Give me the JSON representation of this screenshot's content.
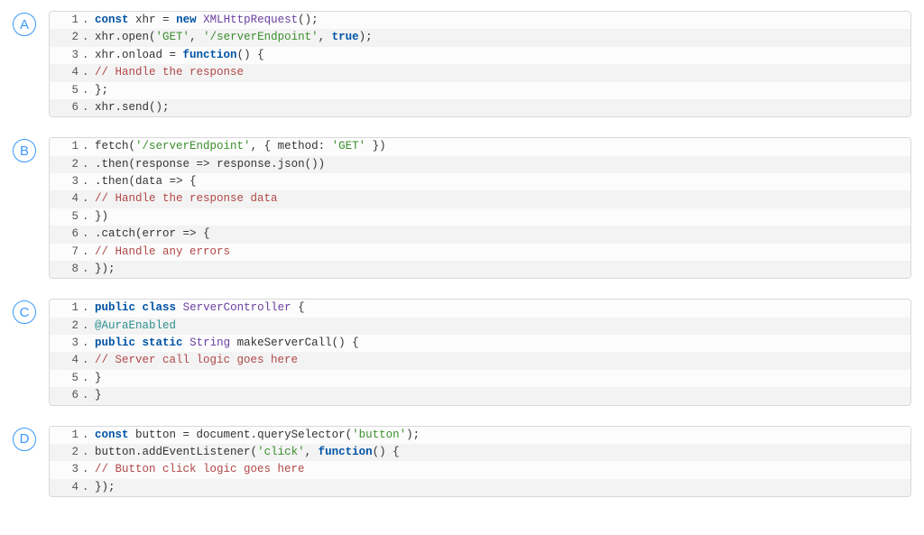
{
  "options": [
    {
      "letter": "A",
      "lines": [
        [
          {
            "t": "kw",
            "v": "const"
          },
          {
            "t": "p",
            "v": " xhr "
          },
          {
            "t": "op",
            "v": "="
          },
          {
            "t": "p",
            "v": " "
          },
          {
            "t": "kw",
            "v": "new"
          },
          {
            "t": "p",
            "v": " "
          },
          {
            "t": "cls",
            "v": "XMLHttpRequest"
          },
          {
            "t": "p",
            "v": "();"
          }
        ],
        [
          {
            "t": "p",
            "v": "xhr."
          },
          {
            "t": "fn",
            "v": "open"
          },
          {
            "t": "p",
            "v": "("
          },
          {
            "t": "str",
            "v": "'GET'"
          },
          {
            "t": "p",
            "v": ", "
          },
          {
            "t": "str",
            "v": "'/serverEndpoint'"
          },
          {
            "t": "p",
            "v": ", "
          },
          {
            "t": "kw",
            "v": "true"
          },
          {
            "t": "p",
            "v": ");"
          }
        ],
        [
          {
            "t": "p",
            "v": "xhr.onload "
          },
          {
            "t": "op",
            "v": "="
          },
          {
            "t": "p",
            "v": " "
          },
          {
            "t": "kw",
            "v": "function"
          },
          {
            "t": "p",
            "v": "() {"
          }
        ],
        [
          {
            "t": "cmt",
            "v": "// Handle the response"
          }
        ],
        [
          {
            "t": "p",
            "v": "};"
          }
        ],
        [
          {
            "t": "p",
            "v": "xhr."
          },
          {
            "t": "fn",
            "v": "send"
          },
          {
            "t": "p",
            "v": "();"
          }
        ]
      ]
    },
    {
      "letter": "B",
      "lines": [
        [
          {
            "t": "fn",
            "v": "fetch"
          },
          {
            "t": "p",
            "v": "("
          },
          {
            "t": "str",
            "v": "'/serverEndpoint'"
          },
          {
            "t": "p",
            "v": ", { method: "
          },
          {
            "t": "str",
            "v": "'GET'"
          },
          {
            "t": "p",
            "v": " })"
          }
        ],
        [
          {
            "t": "p",
            "v": "."
          },
          {
            "t": "fn",
            "v": "then"
          },
          {
            "t": "p",
            "v": "(response "
          },
          {
            "t": "op",
            "v": "=>"
          },
          {
            "t": "p",
            "v": " response."
          },
          {
            "t": "fn",
            "v": "json"
          },
          {
            "t": "p",
            "v": "())"
          }
        ],
        [
          {
            "t": "p",
            "v": "."
          },
          {
            "t": "fn",
            "v": "then"
          },
          {
            "t": "p",
            "v": "(data "
          },
          {
            "t": "op",
            "v": "=>"
          },
          {
            "t": "p",
            "v": " {"
          }
        ],
        [
          {
            "t": "cmt",
            "v": "// Handle the response data"
          }
        ],
        [
          {
            "t": "p",
            "v": "})"
          }
        ],
        [
          {
            "t": "p",
            "v": "."
          },
          {
            "t": "fn",
            "v": "catch"
          },
          {
            "t": "p",
            "v": "(error "
          },
          {
            "t": "op",
            "v": "=>"
          },
          {
            "t": "p",
            "v": " {"
          }
        ],
        [
          {
            "t": "cmt",
            "v": "// Handle any errors"
          }
        ],
        [
          {
            "t": "p",
            "v": "});"
          }
        ]
      ]
    },
    {
      "letter": "C",
      "lines": [
        [
          {
            "t": "kw",
            "v": "public"
          },
          {
            "t": "p",
            "v": " "
          },
          {
            "t": "kw",
            "v": "class"
          },
          {
            "t": "p",
            "v": " "
          },
          {
            "t": "cls",
            "v": "ServerController"
          },
          {
            "t": "p",
            "v": " {"
          }
        ],
        [
          {
            "t": "ann",
            "v": "@AuraEnabled"
          }
        ],
        [
          {
            "t": "kw",
            "v": "public"
          },
          {
            "t": "p",
            "v": " "
          },
          {
            "t": "kw",
            "v": "static"
          },
          {
            "t": "p",
            "v": " "
          },
          {
            "t": "cls",
            "v": "String"
          },
          {
            "t": "p",
            "v": " "
          },
          {
            "t": "fn",
            "v": "makeServerCall"
          },
          {
            "t": "p",
            "v": "() {"
          }
        ],
        [
          {
            "t": "cmt",
            "v": "// Server call logic goes here"
          }
        ],
        [
          {
            "t": "p",
            "v": "}"
          }
        ],
        [
          {
            "t": "p",
            "v": "}"
          }
        ]
      ]
    },
    {
      "letter": "D",
      "lines": [
        [
          {
            "t": "kw",
            "v": "const"
          },
          {
            "t": "p",
            "v": " button "
          },
          {
            "t": "op",
            "v": "="
          },
          {
            "t": "p",
            "v": " document."
          },
          {
            "t": "fn",
            "v": "querySelector"
          },
          {
            "t": "p",
            "v": "("
          },
          {
            "t": "str",
            "v": "'button'"
          },
          {
            "t": "p",
            "v": ");"
          }
        ],
        [
          {
            "t": "p",
            "v": "button."
          },
          {
            "t": "fn",
            "v": "addEventListener"
          },
          {
            "t": "p",
            "v": "("
          },
          {
            "t": "str",
            "v": "'click'"
          },
          {
            "t": "p",
            "v": ", "
          },
          {
            "t": "kw",
            "v": "function"
          },
          {
            "t": "p",
            "v": "() {"
          }
        ],
        [
          {
            "t": "cmt",
            "v": "// Button click logic goes here"
          }
        ],
        [
          {
            "t": "p",
            "v": "});"
          }
        ]
      ]
    }
  ]
}
